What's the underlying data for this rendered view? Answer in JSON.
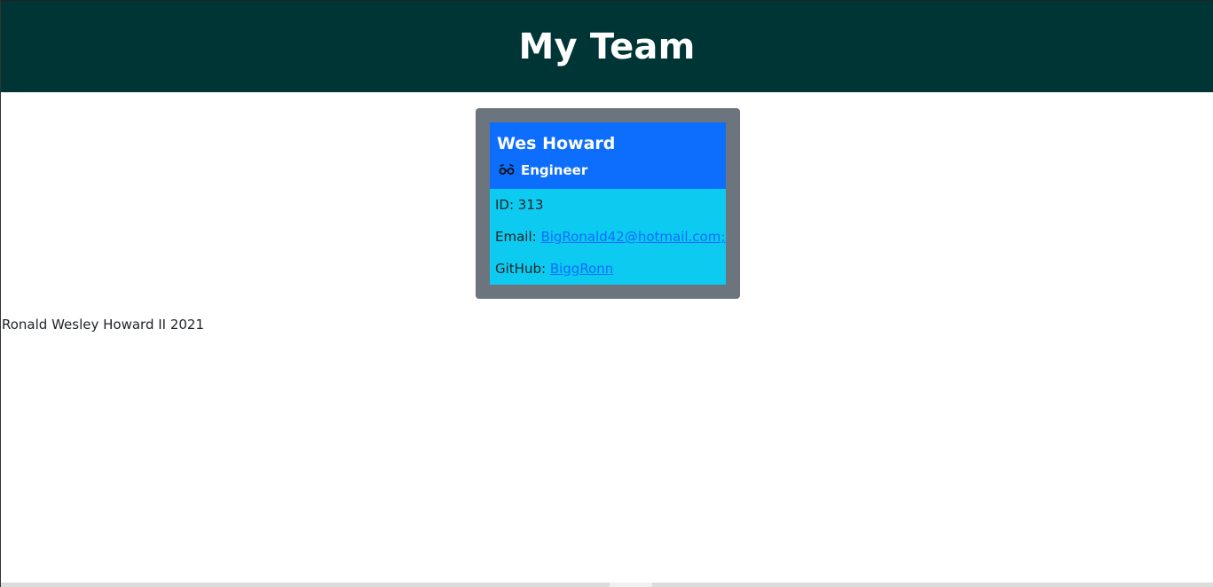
{
  "header": {
    "title": "My Team"
  },
  "employee": {
    "name": "Wes Howard",
    "role": "Engineer",
    "role_icon": "glasses-icon",
    "id_label": "ID: 313",
    "email_label": "Email: ",
    "email": "BigRonald42@hotmail.com;",
    "github_label": "GitHub: ",
    "github": "BiggRonn"
  },
  "footer": {
    "text": "Ronald Wesley Howard II 2021"
  },
  "colors": {
    "header_bg": "#003536",
    "card_outer": "#6c757d",
    "card_head": "#0d6efd",
    "card_body": "#0dcaf0",
    "link": "#0d6efd"
  }
}
